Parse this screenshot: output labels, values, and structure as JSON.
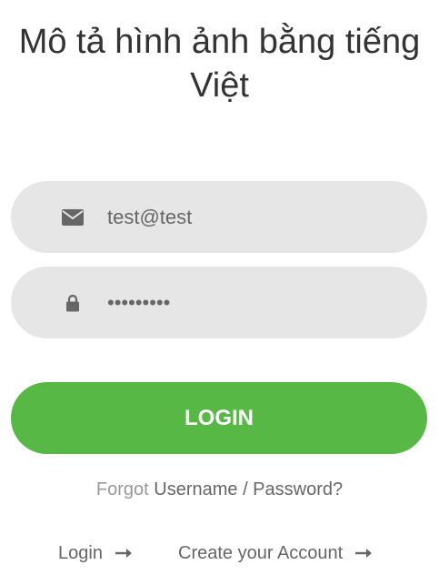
{
  "page": {
    "title": "Mô tả hình ảnh bằng tiếng Việt"
  },
  "form": {
    "email": {
      "icon": "envelope-icon",
      "value": "test@test"
    },
    "password": {
      "icon": "lock-icon",
      "value": "passwordx"
    },
    "login_button": "LOGIN"
  },
  "forgot": {
    "prefix": "Forgot",
    "link": "Username / Password?"
  },
  "footer": {
    "login_link": "Login",
    "create_account_link": "Create your Account",
    "arrow_icon": "arrow-right-icon"
  },
  "colors": {
    "accent": "#57b846",
    "field_bg": "#e6e6e6",
    "text": "#666666",
    "muted": "#999999"
  }
}
